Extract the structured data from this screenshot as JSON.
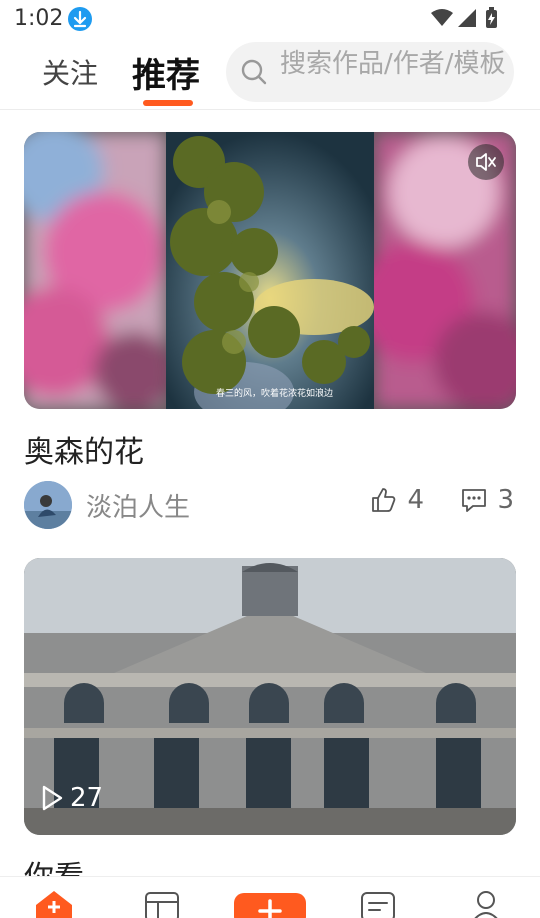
{
  "status_bar": {
    "time": "1:02",
    "icons": [
      "download-badge-icon",
      "wifi-icon",
      "cell-signal-icon",
      "battery-charging-icon"
    ]
  },
  "header": {
    "tabs": [
      {
        "label": "关注",
        "active": false
      },
      {
        "label": "推荐",
        "active": true
      }
    ],
    "search": {
      "placeholder": "搜索作品/作者/模板"
    }
  },
  "feed": [
    {
      "title": "奥森的花",
      "media_type": "video",
      "muted": true,
      "subtitle": "春三的风，吹着花浓花如浪边",
      "author": "淡泊人生",
      "likes": "4",
      "comments": "3"
    },
    {
      "title": "你看",
      "media_type": "photo",
      "play_count": "27"
    }
  ],
  "bottom_nav": {
    "items": [
      "home-icon",
      "templates-icon",
      "create-icon",
      "messages-icon",
      "profile-icon"
    ]
  },
  "colors": {
    "accent": "#ff5a1f",
    "download_badge": "#1e9bf0",
    "text_primary": "#222222",
    "text_secondary": "#888888"
  }
}
